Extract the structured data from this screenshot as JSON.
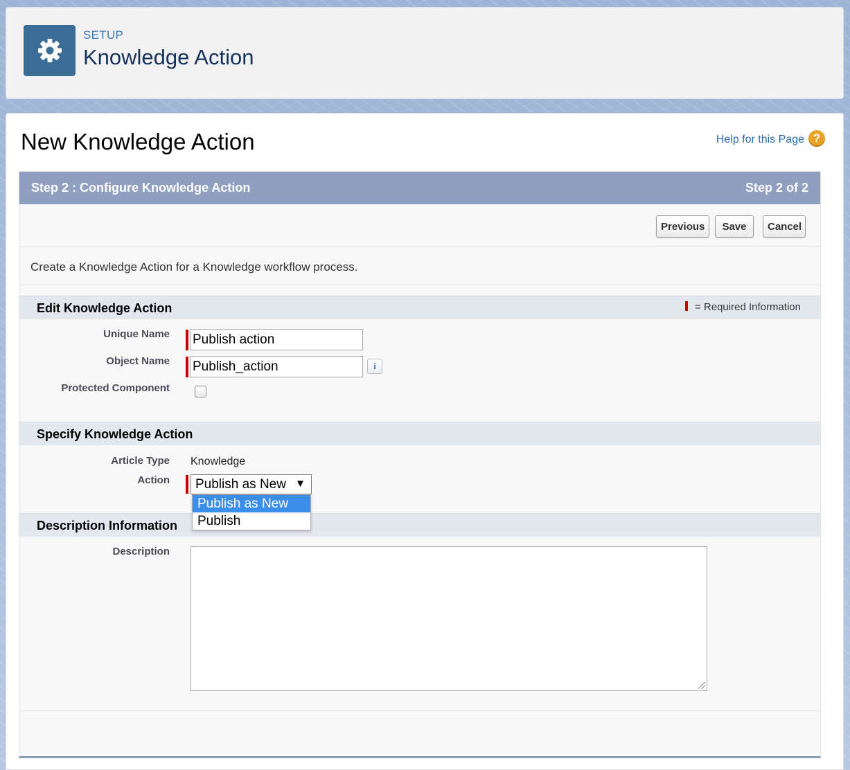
{
  "header": {
    "setup_label": "SETUP",
    "title": "Knowledge Action",
    "icon": "gear-icon"
  },
  "page": {
    "title": "New Knowledge Action",
    "help_link": "Help for this Page",
    "help_icon_glyph": "?"
  },
  "step": {
    "title": "Step 2 : Configure Knowledge Action",
    "count": "Step 2 of 2"
  },
  "buttons": {
    "previous": "Previous",
    "save": "Save",
    "cancel": "Cancel"
  },
  "intro": "Create a Knowledge Action for a Knowledge workflow process.",
  "edit_section": {
    "title": "Edit Knowledge Action",
    "required_info": "= Required Information",
    "unique_name_label": "Unique Name",
    "unique_name_value": "Publish action",
    "object_name_label": "Object Name",
    "object_name_value": "Publish_action",
    "info_glyph": "i",
    "protected_label": "Protected Component",
    "protected_checked": false
  },
  "specify_section": {
    "title": "Specify Knowledge Action",
    "article_type_label": "Article Type",
    "article_type_value": "Knowledge",
    "action_label": "Action",
    "action_selected": "Publish as New",
    "action_arrow": "▼",
    "action_options": [
      "Publish as New",
      "Publish"
    ]
  },
  "description_section": {
    "title": "Description Information",
    "description_label": "Description",
    "description_value": ""
  },
  "colors": {
    "accent": "#3c6d96",
    "step_bar": "#8e9fc0",
    "required": "#cc0000",
    "dropdown_highlight": "#3b8eea"
  }
}
